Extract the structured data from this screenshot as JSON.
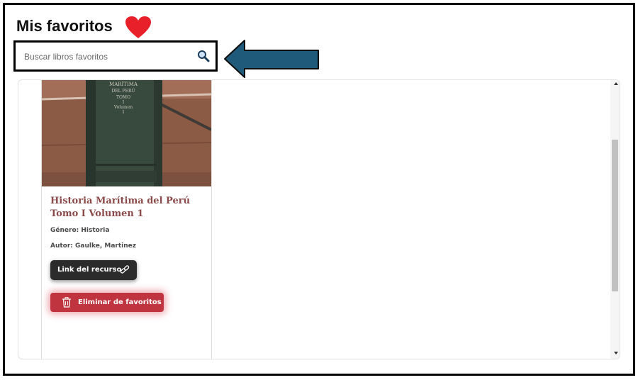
{
  "page": {
    "title": "Mis favoritos"
  },
  "search": {
    "placeholder": "Buscar libros favoritos",
    "value": ""
  },
  "colors": {
    "heart": "#e8202a",
    "arrow_fill": "#1f5a7a",
    "remove_button": "#c0343f",
    "link_button": "#2b2b2b",
    "book_title": "#8b4a4a"
  },
  "icons": {
    "heart": "heart-icon",
    "search": "search-icon",
    "arrow": "arrow-left-icon",
    "link": "link-icon",
    "trash": "trash-icon"
  },
  "favorites": [
    {
      "title": "Historia Marítima del Perú Tomo I Volumen 1",
      "genre": "Género: Historia",
      "author": "Autor: Gaulke, Martinez",
      "link_label": "Link del recurso",
      "remove_label": "Eliminar de favoritos"
    }
  ]
}
